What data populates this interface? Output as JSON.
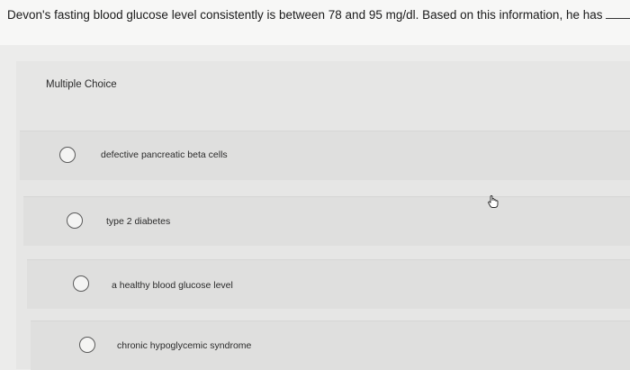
{
  "question": {
    "text": "Devon's fasting blood glucose level consistently is between 78 and 95 mg/dl. Based on this information, he has"
  },
  "multiple_choice_label": "Multiple Choice",
  "options": [
    {
      "label": "defective pancreatic beta cells"
    },
    {
      "label": "type 2 diabetes"
    },
    {
      "label": "a healthy blood glucose level"
    },
    {
      "label": "chronic hypoglycemic syndrome"
    }
  ],
  "icons": {
    "cursor": "hand-pointer-icon",
    "radio": "radio-button-icon"
  },
  "colors": {
    "question_bg": "#f7f7f6",
    "panel_bg": "#e6e6e5",
    "text": "#1f1f1f"
  }
}
